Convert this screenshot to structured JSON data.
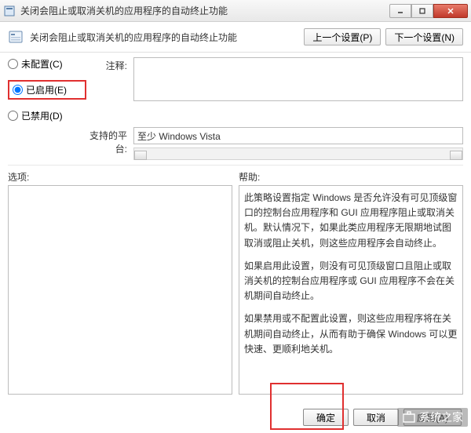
{
  "titlebar": {
    "title": "关闭会阻止或取消关机的应用程序的自动终止功能"
  },
  "header": {
    "title": "关闭会阻止或取消关机的应用程序的自动终止功能",
    "prev": "上一个设置(P)",
    "next": "下一个设置(N)"
  },
  "radios": {
    "not_configured": "未配置(C)",
    "enabled": "已启用(E)",
    "disabled": "已禁用(D)"
  },
  "labels": {
    "comment": "注释:",
    "platform": "支持的平台:",
    "options": "选项:",
    "help": "帮助:"
  },
  "platform_value": "至少 Windows Vista",
  "help_paragraphs": [
    "此策略设置指定 Windows 是否允许没有可见顶级窗口的控制台应用程序和 GUI 应用程序阻止或取消关机。默认情况下，如果此类应用程序无限期地试图取消或阻止关机，则这些应用程序会自动终止。",
    "如果启用此设置，则没有可见顶级窗口且阻止或取消关机的控制台应用程序或 GUI 应用程序不会在关机期间自动终止。",
    "如果禁用或不配置此设置，则这些应用程序将在关机期间自动终止，从而有助于确保 Windows 可以更快速、更顺利地关机。"
  ],
  "buttons": {
    "ok": "确定",
    "cancel": "取消",
    "apply": "应用(A)"
  },
  "watermark": "系统之家"
}
